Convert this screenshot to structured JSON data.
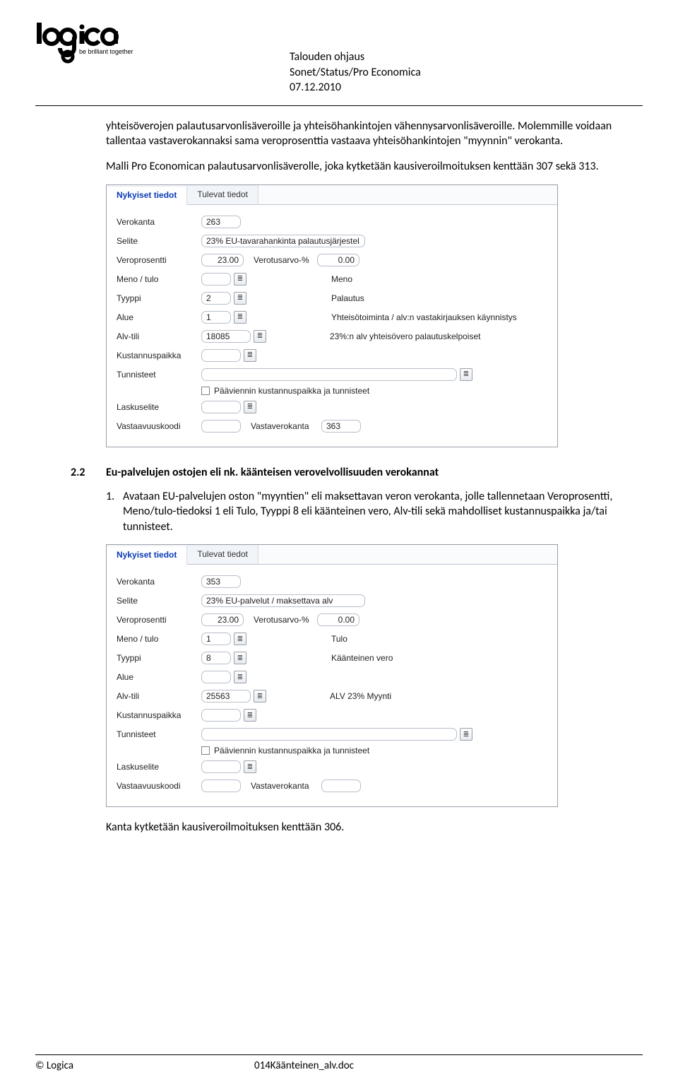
{
  "logo": {
    "tagline": "be brilliant together"
  },
  "header": {
    "line1": "Talouden ohjaus",
    "line2": "Sonet/Status/Pro Economica",
    "line3": "07.12.2010"
  },
  "intro": {
    "para1": "yhteisöverojen palautusarvonlisäveroille ja yhteisöhankintojen vähennysarvonlisäveroille. Molemmille voidaan tallentaa vastaverokannaksi sama veroprosenttia vastaava yhteisöhankintojen \"myynnin\" verokanta.",
    "para2": "Malli Pro Economican palautusarvonlisäverolle, joka kytketään kausiveroilmoituksen kenttään 307 sekä 313."
  },
  "forms": {
    "tabs": {
      "active": "Nykyiset tiedot",
      "other": "Tulevat tiedot"
    },
    "labels": {
      "verokanta": "Verokanta",
      "selite": "Selite",
      "veroprosentti": "Veroprosentti",
      "verotusarvo": "Verotusarvo-%",
      "menotulo": "Meno / tulo",
      "tyyppi": "Tyyppi",
      "alue": "Alue",
      "alvtili": "Alv-tili",
      "kustannuspaikka": "Kustannuspaikka",
      "tunnisteet": "Tunnisteet",
      "paaviennin": "Pääviennin kustannuspaikka ja tunnisteet",
      "laskuselite": "Laskuselite",
      "vastaavuuskoodi": "Vastaavuuskoodi",
      "vastaverokanta": "Vastaverokanta"
    },
    "panel1": {
      "verokanta": "263",
      "selite": "23% EU-tavarahankinta  palautusjärjestel",
      "veroprosentti": "23.00",
      "verotusarvo": "0.00",
      "menotulo_val": "",
      "menotulo_desc": "Meno",
      "tyyppi_val": "2",
      "tyyppi_desc": "Palautus",
      "alue_val": "1",
      "alue_desc": "Yhteisötoiminta / alv:n vastakirjauksen käynnistys",
      "alvtili_val": "18085",
      "alvtili_desc": "23%:n alv yhteisövero palautuskelpoiset",
      "kustannuspaikka": "",
      "tunnisteet": "",
      "laskuselite": "",
      "vastaavuuskoodi": "",
      "vastaverokanta": "363"
    },
    "panel2": {
      "verokanta": "353",
      "selite": "23% EU-palvelut / maksettava alv",
      "veroprosentti": "23.00",
      "verotusarvo": "0.00",
      "menotulo_val": "1",
      "menotulo_desc": "Tulo",
      "tyyppi_val": "8",
      "tyyppi_desc": "Käänteinen vero",
      "alue_val": "",
      "alue_desc": "",
      "alvtili_val": "25563",
      "alvtili_desc": "ALV 23% Myynti",
      "kustannuspaikka": "",
      "tunnisteet": "",
      "laskuselite": "",
      "vastaavuuskoodi": "",
      "vastaverokanta": ""
    }
  },
  "section": {
    "num": "2.2",
    "title": "Eu-palvelujen ostojen eli nk. käänteisen verovelvollisuuden verokannat"
  },
  "item1": {
    "num": "1.",
    "text": "Avataan EU-palvelujen oston \"myyntien\" eli maksettavan veron verokanta, jolle tallennetaan Veroprosentti, Meno/tulo-tiedoksi 1 eli Tulo, Tyyppi 8 eli käänteinen vero, Alv-tili sekä mahdolliset kustannuspaikka ja/tai tunnisteet."
  },
  "trailing": "Kanta kytketään kausiveroilmoituksen kenttään 306.",
  "footer": {
    "left": "© Logica",
    "right": "014Käänteinen_alv.doc"
  }
}
